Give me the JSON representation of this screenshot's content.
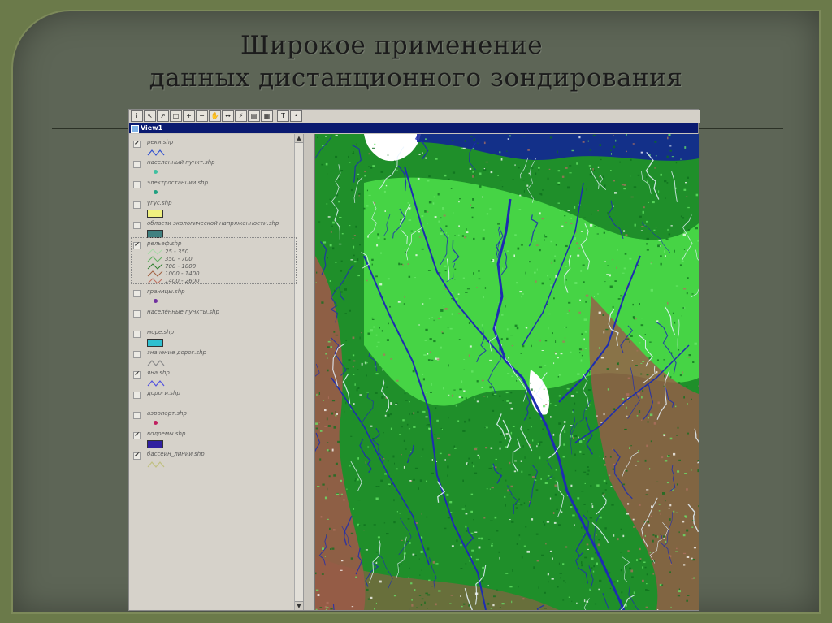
{
  "slide": {
    "title_line1": "Широкое применение",
    "title_line2": "данных дистанционного зондирования"
  },
  "window": {
    "title": "View1",
    "toolbar_text_tool": "T"
  },
  "legend": {
    "layers": [
      {
        "name": "реки.shp",
        "checked": true,
        "symbol": "line",
        "color": "#3050d0"
      },
      {
        "name": "населенный пункт.shp",
        "checked": false,
        "symbol": "dot",
        "color": "#40c0a0"
      },
      {
        "name": "электростанции.shp",
        "checked": false,
        "symbol": "dot",
        "color": "#20a080"
      },
      {
        "name": "угус.shp",
        "checked": false,
        "symbol": "rect",
        "color": "#f0f080"
      },
      {
        "name": "области экологической напряженности.shp",
        "checked": false,
        "symbol": "rect",
        "color": "#408080"
      },
      {
        "name": "рельеф.shp",
        "checked": true,
        "symbol": "classes",
        "classes": [
          {
            "label": "25 - 350",
            "color": "#a8d8a8"
          },
          {
            "label": "350 - 700",
            "color": "#60b060"
          },
          {
            "label": "700 - 1000",
            "color": "#308030"
          },
          {
            "label": "1000 - 1400",
            "color": "#a06040"
          },
          {
            "label": "1400 - 2600",
            "color": "#c07060"
          }
        ]
      },
      {
        "name": "границы.shp",
        "checked": false,
        "symbol": "dot",
        "color": "#7030a0"
      },
      {
        "name": "населённые пункты.shp",
        "checked": false,
        "symbol": "none",
        "color": "#888888"
      },
      {
        "name": "море.shp",
        "checked": false,
        "symbol": "rect",
        "color": "#30c0d0"
      },
      {
        "name": "значение дорог.shp",
        "checked": false,
        "symbol": "line",
        "color": "#888888"
      },
      {
        "name": "яна.shp",
        "checked": true,
        "symbol": "line",
        "color": "#5050e0"
      },
      {
        "name": "дороги.shp",
        "checked": false,
        "symbol": "none",
        "color": "#888888"
      },
      {
        "name": "аэропорт.shp",
        "checked": false,
        "symbol": "dot",
        "color": "#c02060"
      },
      {
        "name": "водоемы.shp",
        "checked": true,
        "symbol": "rect",
        "color": "#3020a0"
      },
      {
        "name": "бассейн_линии.shp",
        "checked": true,
        "symbol": "line",
        "color": "#c0c080"
      }
    ]
  },
  "colors": {
    "title_text": "#1c1c1c",
    "slide_bg": "#5d6556",
    "window_titlebar": "#0a1a70",
    "forest": "#1f8f2a",
    "bright_green": "#4ee04a",
    "mountain": "#9a5a48",
    "river": "#1d2db0",
    "snow": "#ffffff"
  },
  "map_content": "satellite classification of river basin: green vegetation, brown mountains, blue rivers"
}
